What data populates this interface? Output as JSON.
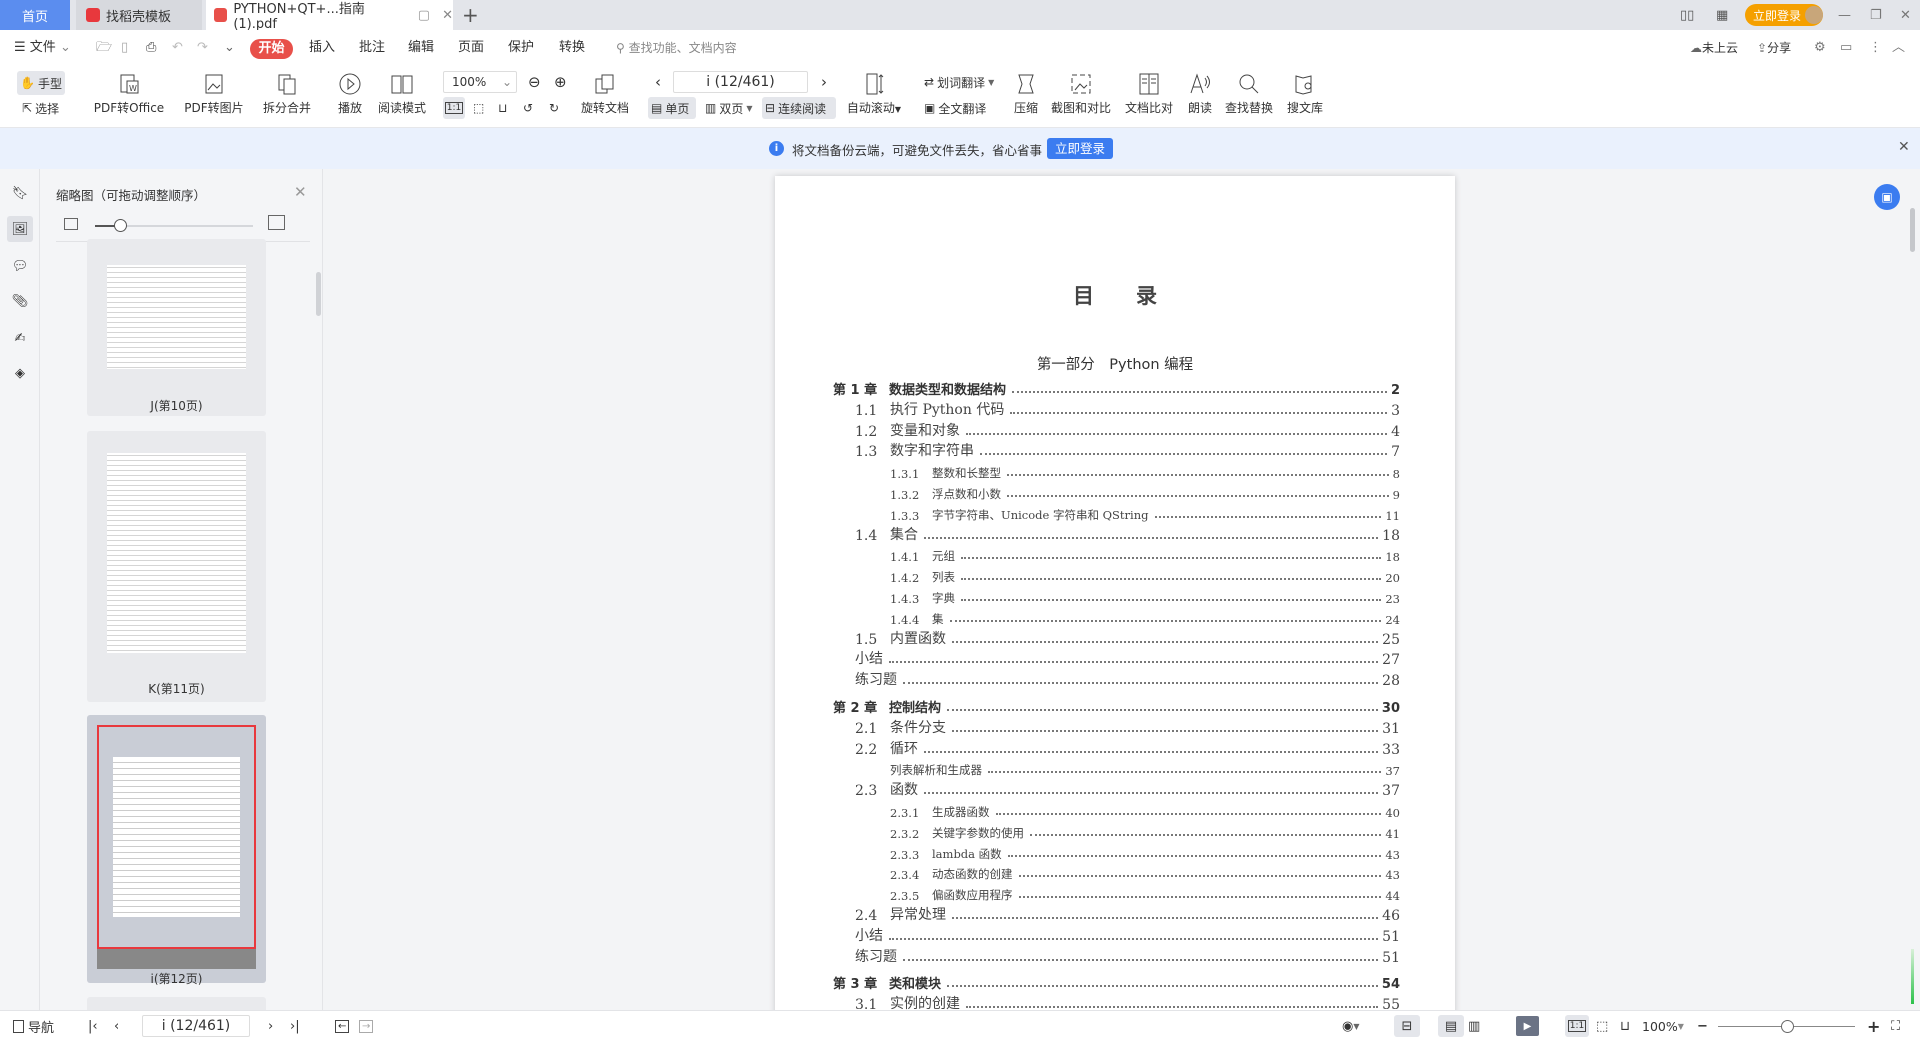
{
  "tabs": [
    {
      "label": "首页"
    },
    {
      "label": "找稻壳模板"
    },
    {
      "label": "PYTHON+QT+...指南 (1).pdf"
    }
  ],
  "titlebar": {
    "login_label": "立即登录"
  },
  "menu": {
    "file": "文件",
    "items": [
      "开始",
      "插入",
      "批注",
      "编辑",
      "页面",
      "保护",
      "转换"
    ],
    "search_placeholder": "查找功能、文档内容",
    "cloud": "未上云",
    "share": "分享"
  },
  "ribbon": {
    "hand": "手型",
    "select": "选择",
    "pdf_office": "PDF转Office",
    "pdf_image": "PDF转图片",
    "split_merge": "拆分合并",
    "play": "播放",
    "read_mode": "阅读模式",
    "zoom": "100%",
    "rotate": "旋转文档",
    "page_indicator": "i (12/461)",
    "single": "单页",
    "double": "双页",
    "continuous": "连续阅读",
    "autoscroll": "自动滚动",
    "word_translate": "划词翻译",
    "full_translate": "全文翻译",
    "compress": "压缩",
    "screenshot_compare": "截图和对比",
    "doc_compare": "文档比对",
    "read_aloud": "朗读",
    "find_replace": "查找替换",
    "search_lib": "搜文库"
  },
  "notice": {
    "text": "将文档备份云端，可避免文件丢失，省心省事",
    "button": "立即登录"
  },
  "thumbnails": {
    "title": "缩略图（可拖动调整顺序）",
    "items": [
      {
        "label": "J(第10页)"
      },
      {
        "label": "K(第11页)"
      },
      {
        "label": "i(第12页)",
        "selected": true
      }
    ]
  },
  "document": {
    "title": "目　　录",
    "part": "第一部分　Python 编程",
    "toc": [
      {
        "level": 0,
        "num": "第 1 章",
        "title": "数据类型和数据结构",
        "page": "2"
      },
      {
        "level": 1,
        "num": "1.1",
        "title": "执行 Python 代码",
        "page": "3"
      },
      {
        "level": 1,
        "num": "1.2",
        "title": "变量和对象",
        "page": "4"
      },
      {
        "level": 1,
        "num": "1.3",
        "title": "数字和字符串",
        "page": "7"
      },
      {
        "level": 2,
        "num": "1.3.1",
        "title": "整数和长整型",
        "page": "8"
      },
      {
        "level": 2,
        "num": "1.3.2",
        "title": "浮点数和小数",
        "page": "9"
      },
      {
        "level": 2,
        "num": "1.3.3",
        "title": "字节字符串、Unicode 字符串和 QString",
        "page": "11"
      },
      {
        "level": 1,
        "num": "1.4",
        "title": "集合",
        "page": "18"
      },
      {
        "level": 2,
        "num": "1.4.1",
        "title": "元组",
        "page": "18"
      },
      {
        "level": 2,
        "num": "1.4.2",
        "title": "列表",
        "page": "20"
      },
      {
        "level": 2,
        "num": "1.4.3",
        "title": "字典",
        "page": "23"
      },
      {
        "level": 2,
        "num": "1.4.4",
        "title": "集",
        "page": "24"
      },
      {
        "level": 1,
        "num": "1.5",
        "title": "内置函数",
        "page": "25"
      },
      {
        "level": 1,
        "num": "",
        "title": "小结",
        "page": "27"
      },
      {
        "level": 1,
        "num": "",
        "title": "练习题",
        "page": "28"
      },
      {
        "level": 0,
        "num": "第 2 章",
        "title": "控制结构",
        "page": "30"
      },
      {
        "level": 1,
        "num": "2.1",
        "title": "条件分支",
        "page": "31"
      },
      {
        "level": 1,
        "num": "2.2",
        "title": "循环",
        "page": "33"
      },
      {
        "level": 2,
        "num": "",
        "title": "列表解析和生成器",
        "page": "37"
      },
      {
        "level": 1,
        "num": "2.3",
        "title": "函数",
        "page": "37"
      },
      {
        "level": 2,
        "num": "2.3.1",
        "title": "生成器函数",
        "page": "40"
      },
      {
        "level": 2,
        "num": "2.3.2",
        "title": "关键字参数的使用",
        "page": "41"
      },
      {
        "level": 2,
        "num": "2.3.3",
        "title": "lambda 函数",
        "page": "43"
      },
      {
        "level": 2,
        "num": "2.3.4",
        "title": "动态函数的创建",
        "page": "43"
      },
      {
        "level": 2,
        "num": "2.3.5",
        "title": "偏函数应用程序",
        "page": "44"
      },
      {
        "level": 1,
        "num": "2.4",
        "title": "异常处理",
        "page": "46"
      },
      {
        "level": 1,
        "num": "",
        "title": "小结",
        "page": "51"
      },
      {
        "level": 1,
        "num": "",
        "title": "练习题",
        "page": "51"
      },
      {
        "level": 0,
        "num": "第 3 章",
        "title": "类和模块",
        "page": "54"
      },
      {
        "level": 1,
        "num": "3.1",
        "title": "实例的创建",
        "page": "55"
      }
    ]
  },
  "statusbar": {
    "nav": "导航",
    "page_indicator": "i (12/461)",
    "zoom": "100%"
  },
  "colors": {
    "accent": "#3b7cf0",
    "start_tab": "#e8504a",
    "login": "#f5a000",
    "home_tab": "#5b8def"
  }
}
